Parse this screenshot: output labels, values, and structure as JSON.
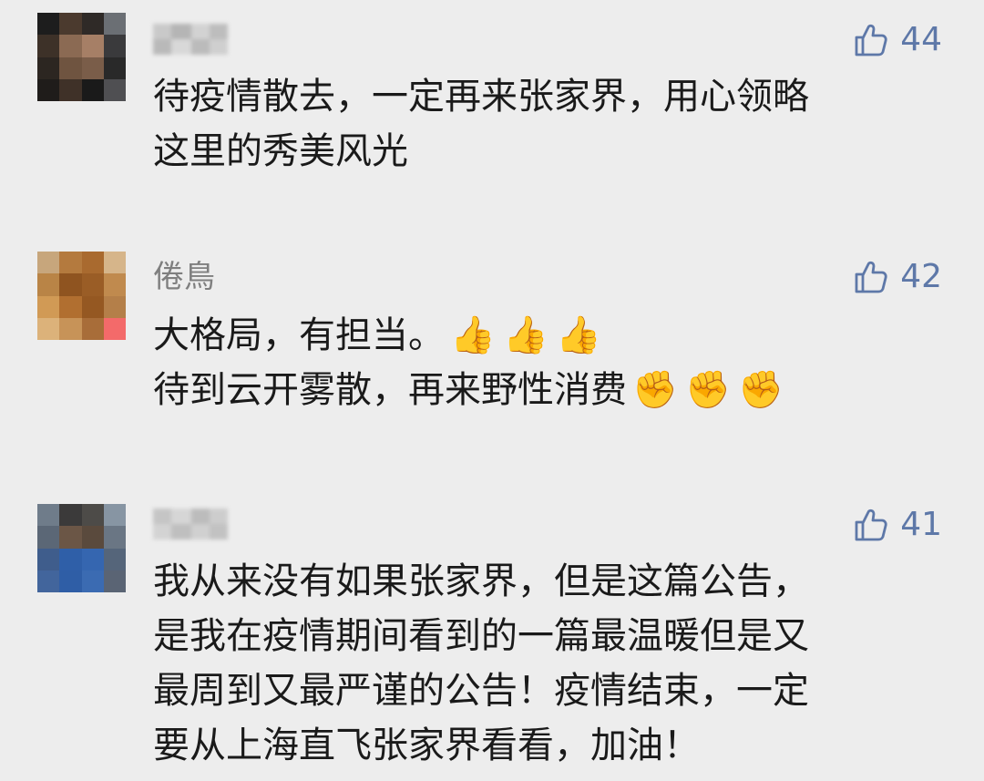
{
  "comments": [
    {
      "nickname": "",
      "likes": "44",
      "lines": [
        {
          "text": "待疫情散去，一定再来张家界，用心领略"
        },
        {
          "text": "这里的秀美风光"
        }
      ]
    },
    {
      "nickname": "倦鳥",
      "likes": "42",
      "lines": [
        {
          "text": "大格局，有担当。",
          "emoji": "👍",
          "emoji_count": 3
        },
        {
          "text": "待到云开雾散，再来野性消费",
          "emoji": "✊",
          "emoji_count": 3
        }
      ]
    },
    {
      "nickname": "",
      "likes": "41",
      "lines": [
        {
          "text": "我从来没有如果张家界，但是这篇公告，"
        },
        {
          "text": "是我在疫情期间看到的一篇最温暖但是又"
        },
        {
          "text": "最周到又最严谨的公告！疫情结束，一定"
        },
        {
          "text": "要从上海直飞张家界看看，加油！"
        }
      ]
    }
  ],
  "colors": {
    "background": "#ededed",
    "like": "#5e78a8",
    "nickname": "#7f7f7f",
    "text": "#1a1a1a"
  },
  "icons": {
    "like": "thumbs-up-outline-icon"
  }
}
